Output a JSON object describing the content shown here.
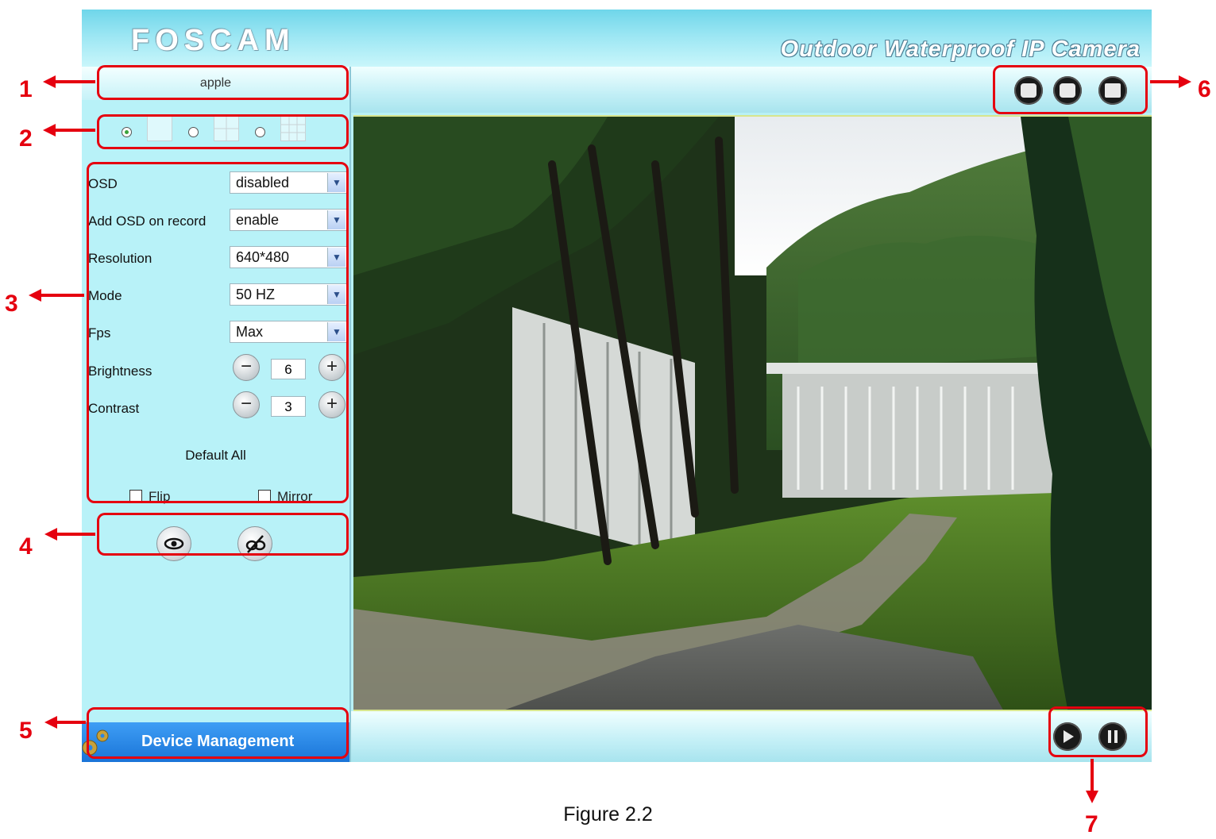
{
  "header": {
    "logo_text": "FOSCAM",
    "product_title": "Outdoor Waterproof IP Camera"
  },
  "camera": {
    "name": "apple"
  },
  "layout": {
    "options": [
      {
        "name": "single-view",
        "selected": true
      },
      {
        "name": "four-view",
        "selected": false
      },
      {
        "name": "nine-view",
        "selected": false
      }
    ]
  },
  "settings": {
    "osd": {
      "label": "OSD",
      "value": "disabled"
    },
    "add_osd_on_record": {
      "label": "Add OSD on record",
      "value": "enable"
    },
    "resolution": {
      "label": "Resolution",
      "value": "640*480"
    },
    "mode": {
      "label": "Mode",
      "value": "50 HZ"
    },
    "fps": {
      "label": "Fps",
      "value": "Max"
    },
    "brightness": {
      "label": "Brightness",
      "value": "6",
      "minus": "−",
      "plus": "+"
    },
    "contrast": {
      "label": "Contrast",
      "value": "3",
      "minus": "−",
      "plus": "+"
    },
    "default_all": "Default All",
    "flip": {
      "label": "Flip",
      "checked": false
    },
    "mirror": {
      "label": "Mirror",
      "checked": false
    }
  },
  "ir_controls": {
    "ir_on_icon": "eye-icon",
    "ir_off_icon": "eye-off-icon"
  },
  "device_management": {
    "label": "Device Management",
    "icon": "gear-icon"
  },
  "toolbar_top": {
    "buttons": [
      "record-icon",
      "snapshot-icon",
      "fullscreen-icon"
    ]
  },
  "toolbar_bottom": {
    "buttons": [
      "play-icon",
      "stop-icon"
    ]
  },
  "annotations": [
    "1",
    "2",
    "3",
    "4",
    "5",
    "6",
    "7"
  ],
  "caption": "Figure 2.2",
  "colors": {
    "annotation": "#e5000f",
    "sidebar_bg": "#b8f2f8",
    "device_mgmt_bg": "#2a86e6"
  }
}
